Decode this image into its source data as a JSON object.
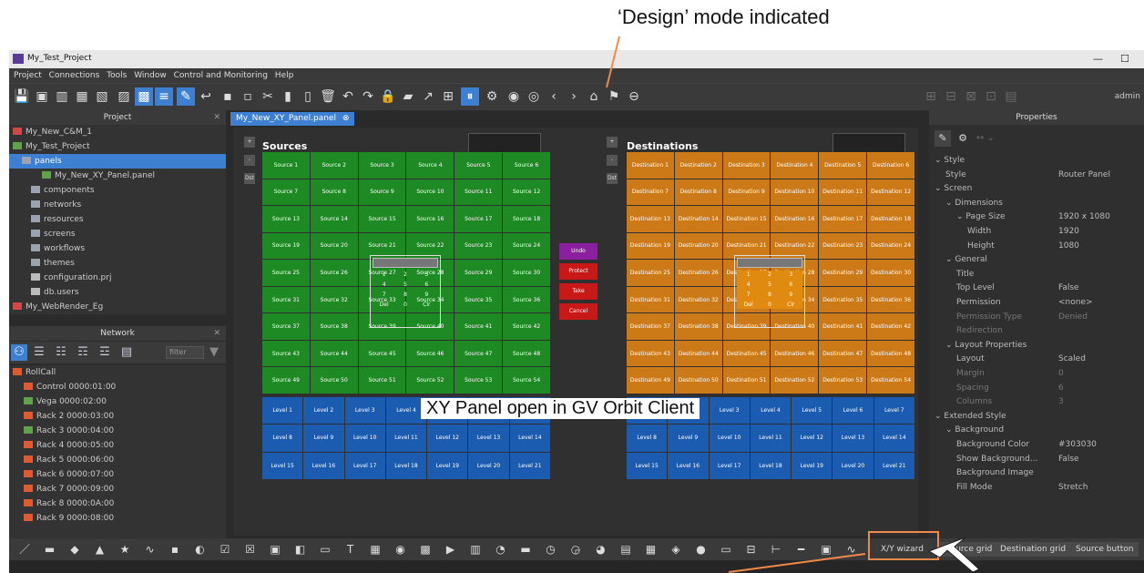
{
  "annotations": {
    "design_mode": "‘Design’ mode indicated",
    "xy_panel": "XY Panel open in GV Orbit Client"
  },
  "window": {
    "title": "My_Test_Project",
    "controls": [
      "—",
      "☐"
    ]
  },
  "menu": [
    "Project",
    "Connections",
    "Tools",
    "Window",
    "Control and Monitoring",
    "Help"
  ],
  "user": "admin",
  "project_panel": {
    "title": "Project",
    "items": [
      {
        "label": "My_New_C&M_1"
      },
      {
        "label": "My_Test_Project"
      },
      {
        "label": "panels"
      },
      {
        "label": "My_New_XY_Panel.panel"
      },
      {
        "label": "components"
      },
      {
        "label": "networks"
      },
      {
        "label": "resources"
      },
      {
        "label": "screens"
      },
      {
        "label": "workflows"
      },
      {
        "label": "themes"
      },
      {
        "label": "configuration.prj"
      },
      {
        "label": "db.users"
      },
      {
        "label": "My_WebRender_Eg"
      }
    ]
  },
  "network_panel": {
    "title": "Network",
    "filter_placeholder": "filter",
    "items": [
      {
        "label": "RollCall"
      },
      {
        "label": "Control 0000:01:00"
      },
      {
        "label": "Vega 0000:02:00"
      },
      {
        "label": "Rack 2 0000:03:00"
      },
      {
        "label": "Rack 3 0000:04:00"
      },
      {
        "label": "Rack 4 0000:05:00"
      },
      {
        "label": "Rack 5 0000:06:00"
      },
      {
        "label": "Rack 6 0000:07:00"
      },
      {
        "label": "Rack 7 0000:09:00"
      },
      {
        "label": "Rack 8 0000:0A:00"
      },
      {
        "label": "Rack 9 0000:08:00"
      }
    ]
  },
  "document": {
    "tab_label": "My_New_XY_Panel.panel",
    "sources_title": "Sources",
    "destinations_title": "Destinations",
    "sources": [
      "Source 1",
      "Source 2",
      "Source 3",
      "Source 4",
      "Source 5",
      "Source 6",
      "Source 7",
      "Source 8",
      "Source 9",
      "Source 10",
      "Source 11",
      "Source 12",
      "Source 13",
      "Source 14",
      "Source 15",
      "Source 16",
      "Source 17",
      "Source 18",
      "Source 19",
      "Source 20",
      "Source 21",
      "Source 22",
      "Source 23",
      "Source 24",
      "Source 25",
      "Source 26",
      "Source 27",
      "Source 28",
      "Source 29",
      "Source 30",
      "Source 31",
      "Source 32",
      "Source 33",
      "Source 34",
      "Source 35",
      "Source 36",
      "Source 37",
      "Source 38",
      "Source 39",
      "Source 40",
      "Source 41",
      "Source 42",
      "Source 43",
      "Source 44",
      "Source 45",
      "Source 46",
      "Source 47",
      "Source 48",
      "Source 49",
      "Source 50",
      "Source 51",
      "Source 52",
      "Source 53",
      "Source 54"
    ],
    "destinations": [
      "Destination 1",
      "Destination 2",
      "Destination 3",
      "Destination 4",
      "Destination 5",
      "Destination 6",
      "Destination 7",
      "Destination 8",
      "Destination 9",
      "Destination 10",
      "Destination 11",
      "Destination 12",
      "Destination 13",
      "Destination 14",
      "Destination 15",
      "Destination 16",
      "Destination 17",
      "Destination 18",
      "Destination 19",
      "Destination 20",
      "Destination 21",
      "Destination 22",
      "Destination 23",
      "Destination 24",
      "Destination 25",
      "Destination 26",
      "Destination 27",
      "Destination 28",
      "Destination 29",
      "Destination 30",
      "Destination 31",
      "Destination 32",
      "Destination 33",
      "Destination 34",
      "Destination 35",
      "Destination 36",
      "Destination 37",
      "Destination 38",
      "Destination 39",
      "Destination 40",
      "Destination 41",
      "Destination 42",
      "Destination 43",
      "Destination 44",
      "Destination 45",
      "Destination 46",
      "Destination 47",
      "Destination 48",
      "Destination 49",
      "Destination 50",
      "Destination 51",
      "Destination 52",
      "Destination 53",
      "Destination 54"
    ],
    "levels": [
      "Level 1",
      "Level 2",
      "Level 3",
      "Level 4",
      "Level 5",
      "Level 6",
      "Level 7",
      "Level 8",
      "Level 9",
      "Level 10",
      "Level 11",
      "Level 12",
      "Level 13",
      "Level 14",
      "Level 15",
      "Level 16",
      "Level 17",
      "Level 18",
      "Level 19",
      "Level 20",
      "Level 21"
    ],
    "keypad_keys": [
      "1",
      "2",
      "3",
      "4",
      "5",
      "6",
      "7",
      "8",
      "9",
      "Del",
      "0",
      "Clr"
    ],
    "side_buttons": [
      "+",
      "-",
      "Dst"
    ],
    "actions": [
      {
        "label": "Undo",
        "color": "#8b1fa0"
      },
      {
        "label": "Protect",
        "color": "#c81818"
      },
      {
        "label": "Take",
        "color": "#c81818"
      },
      {
        "label": "Cancel",
        "color": "#c81818"
      }
    ],
    "selector_label": "Src"
  },
  "properties": {
    "title": "Properties",
    "rows": [
      {
        "label": "Style",
        "value": "",
        "level": 0,
        "dim": false
      },
      {
        "label": "Style",
        "value": "Router Panel",
        "level": 1,
        "dim": false
      },
      {
        "label": "Screen",
        "value": "",
        "level": 0,
        "dim": false
      },
      {
        "label": "Dimensions",
        "value": "",
        "level": 1,
        "dim": false
      },
      {
        "label": "Page Size",
        "value": "1920 x 1080",
        "level": 2,
        "dim": false
      },
      {
        "label": "Width",
        "value": "1920",
        "level": 3,
        "dim": false
      },
      {
        "label": "Height",
        "value": "1080",
        "level": 3,
        "dim": false
      },
      {
        "label": "General",
        "value": "",
        "level": 1,
        "dim": false
      },
      {
        "label": "Title",
        "value": "",
        "level": 2,
        "dim": false
      },
      {
        "label": "Top Level",
        "value": "False",
        "level": 2,
        "dim": false
      },
      {
        "label": "Permission",
        "value": "<none>",
        "level": 2,
        "dim": false
      },
      {
        "label": "Permission Type",
        "value": "Denied",
        "level": 2,
        "dim": true
      },
      {
        "label": "Redirection",
        "value": "",
        "level": 2,
        "dim": true
      },
      {
        "label": "Layout Properties",
        "value": "",
        "level": 1,
        "dim": false
      },
      {
        "label": "Layout",
        "value": "Scaled",
        "level": 2,
        "dim": false
      },
      {
        "label": "Margin",
        "value": "0",
        "level": 2,
        "dim": true
      },
      {
        "label": "Spacing",
        "value": "6",
        "level": 2,
        "dim": true
      },
      {
        "label": "Columns",
        "value": "3",
        "level": 2,
        "dim": true
      },
      {
        "label": "Extended Style",
        "value": "",
        "level": 0,
        "dim": false
      },
      {
        "label": "Background",
        "value": "",
        "level": 1,
        "dim": false
      },
      {
        "label": "Background Color",
        "value": "#303030",
        "level": 2,
        "dim": false
      },
      {
        "label": "Show Background...",
        "value": "False",
        "level": 2,
        "dim": false
      },
      {
        "label": "Background Image",
        "value": "",
        "level": 2,
        "dim": false
      },
      {
        "label": "Fill Mode",
        "value": "Stretch",
        "level": 2,
        "dim": false
      }
    ]
  },
  "bottom_toolbar": {
    "wizards": [
      "X/Y wizard",
      "Source grid",
      "Destination grid",
      "Source button"
    ]
  },
  "colors": {
    "source": "#1e8a23",
    "destination": "#cc7a17",
    "level": "#1c5cb0",
    "accent": "#3d7fd0",
    "callout": "#f08a4b"
  }
}
